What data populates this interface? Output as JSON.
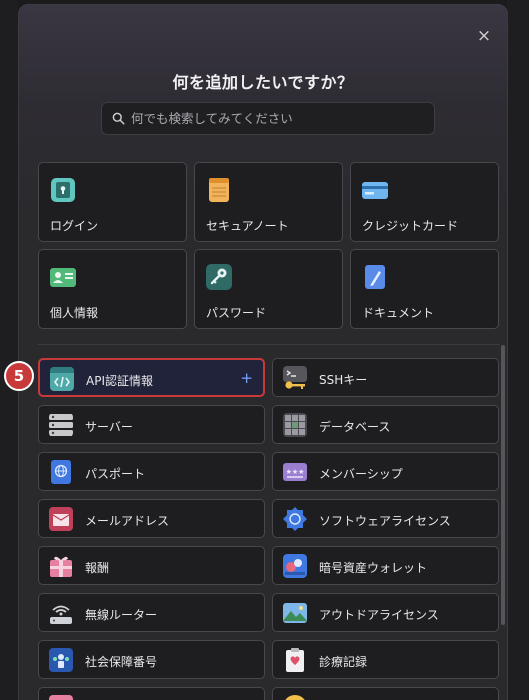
{
  "dialog": {
    "title": "何を追加したいですか？",
    "close_glyph": "×",
    "search_placeholder": "何でも検索してみてください"
  },
  "categories": [
    {
      "label": "ログイン",
      "icon": "login-lock-icon",
      "color": "#5fc7c0"
    },
    {
      "label": "セキュアノート",
      "icon": "secure-note-icon",
      "color": "#f2b45a"
    },
    {
      "label": "クレジットカード",
      "icon": "credit-card-icon",
      "color": "#6fb6f0"
    },
    {
      "label": "個人情報",
      "icon": "identity-card-icon",
      "color": "#52b97a"
    },
    {
      "label": "パスワード",
      "icon": "key-icon",
      "color": "#3f8a84"
    },
    {
      "label": "ドキュメント",
      "icon": "document-icon",
      "color": "#5b8be8"
    }
  ],
  "items": [
    {
      "label": "API認証情報",
      "icon": "api-code-icon",
      "selected": true,
      "action": "+"
    },
    {
      "label": "SSHキー",
      "icon": "ssh-terminal-key-icon"
    },
    {
      "label": "サーバー",
      "icon": "server-icon"
    },
    {
      "label": "データベース",
      "icon": "database-grid-icon"
    },
    {
      "label": "パスポート",
      "icon": "passport-globe-icon"
    },
    {
      "label": "メンバーシップ",
      "icon": "membership-stars-icon"
    },
    {
      "label": "メールアドレス",
      "icon": "email-envelope-icon"
    },
    {
      "label": "ソフトウェアライセンス",
      "icon": "software-license-badge-icon"
    },
    {
      "label": "報酬",
      "icon": "reward-gift-icon"
    },
    {
      "label": "暗号資産ウォレット",
      "icon": "crypto-wallet-icon"
    },
    {
      "label": "無線ルーター",
      "icon": "wifi-router-icon"
    },
    {
      "label": "アウトドアライセンス",
      "icon": "outdoor-license-icon"
    },
    {
      "label": "社会保障番号",
      "icon": "social-security-icon"
    },
    {
      "label": "診療記録",
      "icon": "medical-record-icon"
    }
  ],
  "step_badge": "5"
}
